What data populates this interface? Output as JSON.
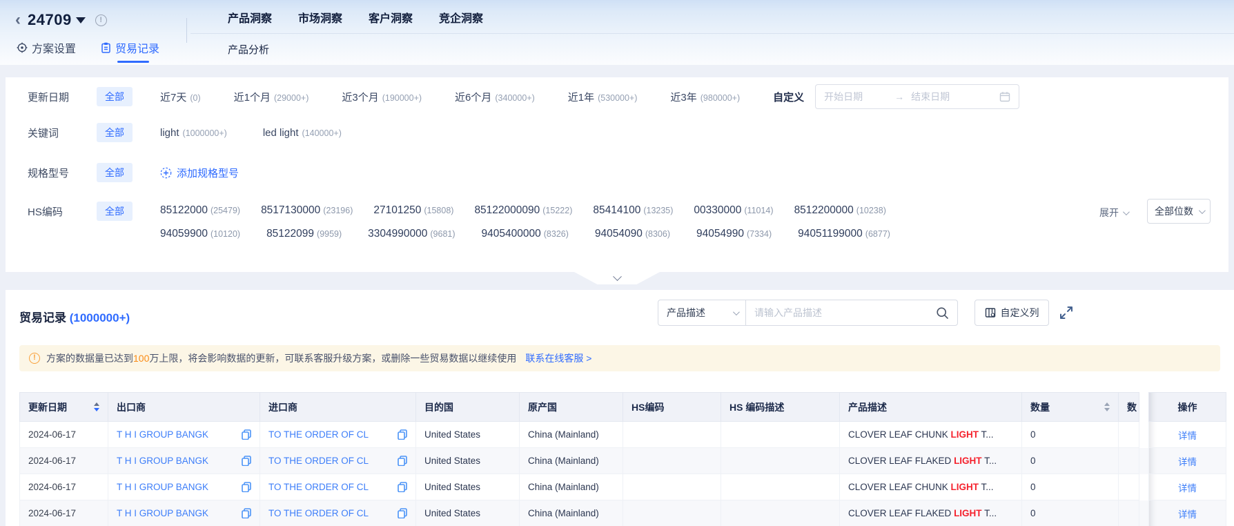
{
  "icons": {
    "back": "‹",
    "range_arrow": "→",
    "info_mark": "!",
    "warn_mark": "!"
  },
  "header": {
    "title": "24709",
    "left_tabs": [
      {
        "label": "方案设置"
      },
      {
        "label": "贸易记录"
      }
    ],
    "nav_tabs": [
      {
        "label": "产品洞察"
      },
      {
        "label": "市场洞察"
      },
      {
        "label": "客户洞察"
      },
      {
        "label": "竞企洞察"
      }
    ],
    "sub_tab": "产品分析"
  },
  "filters": {
    "update_date": {
      "label": "更新日期",
      "all": "全部",
      "options": [
        {
          "label": "近7天",
          "count": "(0)"
        },
        {
          "label": "近1个月",
          "count": "(29000+)"
        },
        {
          "label": "近3个月",
          "count": "(190000+)"
        },
        {
          "label": "近6个月",
          "count": "(340000+)"
        },
        {
          "label": "近1年",
          "count": "(530000+)"
        },
        {
          "label": "近3年",
          "count": "(980000+)"
        }
      ],
      "custom_label": "自定义",
      "start_placeholder": "开始日期",
      "end_placeholder": "结束日期"
    },
    "keyword": {
      "label": "关键词",
      "all": "全部",
      "options": [
        {
          "label": "light",
          "count": "(1000000+)"
        },
        {
          "label": "led light",
          "count": "(140000+)"
        }
      ]
    },
    "spec": {
      "label": "规格型号",
      "all": "全部",
      "add_label": "添加规格型号"
    },
    "hs": {
      "label": "HS编码",
      "all": "全部",
      "line1": [
        {
          "code": "85122000",
          "count": "(25479)"
        },
        {
          "code": "8517130000",
          "count": "(23196)"
        },
        {
          "code": "27101250",
          "count": "(15808)"
        },
        {
          "code": "85122000090",
          "count": "(15222)"
        },
        {
          "code": "85414100",
          "count": "(13235)"
        },
        {
          "code": "00330000",
          "count": "(11014)"
        },
        {
          "code": "8512200000",
          "count": "(10238)"
        }
      ],
      "line2": [
        {
          "code": "94059900",
          "count": "(10120)"
        },
        {
          "code": "85122099",
          "count": "(9959)"
        },
        {
          "code": "3304990000",
          "count": "(9681)"
        },
        {
          "code": "9405400000",
          "count": "(8326)"
        },
        {
          "code": "94054090",
          "count": "(8306)"
        },
        {
          "code": "94054990",
          "count": "(7334)"
        },
        {
          "code": "94051199000",
          "count": "(6877)"
        }
      ],
      "expand_label": "展开",
      "digits_label": "全部位数"
    }
  },
  "records": {
    "title": "贸易记录",
    "count": "(1000000+)",
    "search_field": "产品描述",
    "search_placeholder": "请输入产品描述",
    "customize_label": "自定义列",
    "warning": {
      "text_before": "方案的数据量已达到",
      "highlight": "100",
      "text_after": "万上限，将会影响数据的更新，可联系客服升级方案，或删除一些贸易数据以继续使用",
      "link": "联系在线客服 >"
    },
    "table": {
      "headers": {
        "date": "更新日期",
        "exporter": "出口商",
        "importer": "进口商",
        "dest": "目的国",
        "origin": "原产国",
        "hs": "HS编码",
        "hs_desc": "HS 编码描述",
        "product": "产品描述",
        "qty": "数量",
        "qty2": "数",
        "action": "操作"
      },
      "rows": [
        {
          "date": "2024-06-17",
          "exporter": "T H I GROUP BANGK",
          "importer": "TO THE ORDER OF CL",
          "dest": "United States",
          "origin": "China (Mainland)",
          "hs": "",
          "hs_desc": "",
          "product_pre": "CLOVER LEAF CHUNK ",
          "product_hl": "LIGHT",
          "product_post": " T...",
          "qty": "0",
          "action": "详情"
        },
        {
          "date": "2024-06-17",
          "exporter": "T H I GROUP BANGK",
          "importer": "TO THE ORDER OF CL",
          "dest": "United States",
          "origin": "China (Mainland)",
          "hs": "",
          "hs_desc": "",
          "product_pre": "CLOVER LEAF FLAKED ",
          "product_hl": "LIGHT",
          "product_post": " T...",
          "qty": "0",
          "action": "详情"
        },
        {
          "date": "2024-06-17",
          "exporter": "T H I GROUP BANGK",
          "importer": "TO THE ORDER OF CL",
          "dest": "United States",
          "origin": "China (Mainland)",
          "hs": "",
          "hs_desc": "",
          "product_pre": "CLOVER LEAF CHUNK ",
          "product_hl": "LIGHT",
          "product_post": " T...",
          "qty": "0",
          "action": "详情"
        },
        {
          "date": "2024-06-17",
          "exporter": "T H I GROUP BANGK",
          "importer": "TO THE ORDER OF CL",
          "dest": "United States",
          "origin": "China (Mainland)",
          "hs": "",
          "hs_desc": "",
          "product_pre": "CLOVER LEAF FLAKED ",
          "product_hl": "LIGHT",
          "product_post": " T...",
          "qty": "0",
          "action": "详情"
        }
      ]
    }
  },
  "colors": {
    "accent": "#2F6BFF",
    "link": "#3D7EF9",
    "red_highlight": "#F5222D",
    "warning_orange": "#FA8C16",
    "warning_bg": "#FCF6E6"
  }
}
